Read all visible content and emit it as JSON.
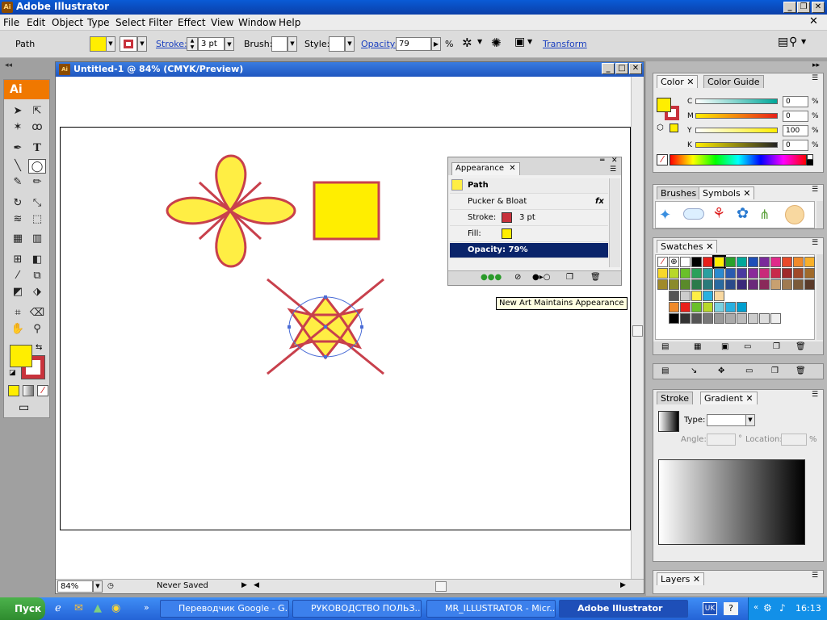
{
  "window": {
    "title": "Adobe Illustrator",
    "logo_text": "Ai"
  },
  "menu": [
    "File",
    "Edit",
    "Object",
    "Type",
    "Select",
    "Filter",
    "Effect",
    "View",
    "Window",
    "Help"
  ],
  "control_bar": {
    "selection": "Path",
    "fill_color": "#ffee00",
    "stroke_color": "#c8323c",
    "stroke_label": "Stroke:",
    "stroke_value": "3 pt",
    "brush_label": "Brush:",
    "style_label": "Style:",
    "opacity_label": "Opacity:",
    "opacity_value": "79",
    "opacity_unit": "%",
    "transform_label": "Transform"
  },
  "tools": {
    "logo": "Ai"
  },
  "document": {
    "title": "Untitled-1 @ 84% (CMYK/Preview)",
    "zoom": "84%",
    "status": "Never Saved"
  },
  "appearance": {
    "tab": "Appearance",
    "header": "Path",
    "rows": [
      {
        "label": "Pucker & Bloat",
        "value": ""
      },
      {
        "label": "Stroke:",
        "value": "3 pt"
      },
      {
        "label": "Fill:",
        "value": ""
      },
      {
        "label": "Opacity: 79%",
        "value": ""
      }
    ],
    "fx": "fx"
  },
  "tooltip": "New Art Maintains Appearance",
  "color_panel": {
    "tabs": [
      "Color",
      "Color Guide"
    ],
    "channels": [
      {
        "name": "C",
        "value": "0",
        "unit": "%"
      },
      {
        "name": "M",
        "value": "0",
        "unit": "%"
      },
      {
        "name": "Y",
        "value": "100",
        "unit": "%"
      },
      {
        "name": "K",
        "value": "0",
        "unit": "%"
      }
    ]
  },
  "brushes_panel": {
    "tabs": [
      "Brushes",
      "Symbols"
    ]
  },
  "swatches_panel": {
    "tabs": [
      "Swatches"
    ]
  },
  "gradient_panel": {
    "tabs": [
      "Stroke",
      "Gradient"
    ],
    "type_label": "Type:",
    "angle_label": "Angle:",
    "angle_unit": "°",
    "location_label": "Location:",
    "location_unit": "%"
  },
  "layers_panel": {
    "tabs": [
      "Layers"
    ]
  },
  "taskbar": {
    "start": "Пуск",
    "tasks": [
      "Переводчик Google - G...",
      "РУКОВОДСТВО ПОЛЬЗ...",
      "MR_ILLUSTRATOR - Micr...",
      "Adobe Illustrator"
    ],
    "lang": "UK",
    "clock": "16:13"
  }
}
